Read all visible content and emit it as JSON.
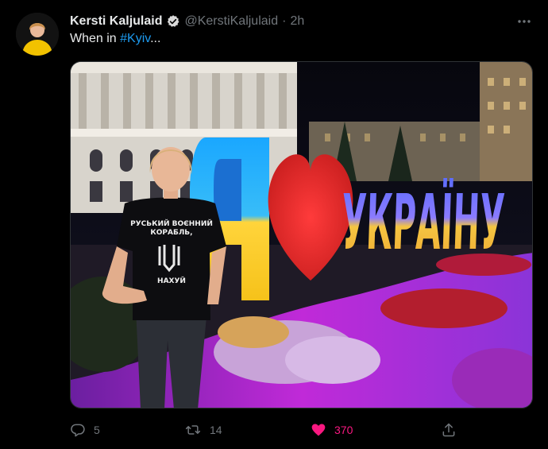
{
  "author": {
    "display_name": "Kersti Kaljulaid",
    "handle": "@KerstiKaljulaid",
    "separator": "·",
    "time": "2h",
    "verified": true
  },
  "tweet": {
    "text_prefix": "When in ",
    "hashtag": "#Kyiv",
    "text_suffix": "..."
  },
  "media": {
    "shirt_lines": [
      "РУСЬКИЙ ВОЄННИЙ",
      "КОРАБЛЬ,",
      "НАХУЙ"
    ],
    "sign_text": "УКРАЇНУ"
  },
  "actions": {
    "replies": "5",
    "retweets": "14",
    "likes": "370",
    "liked": true
  },
  "icons": {
    "verified": "verified-badge-icon",
    "more": "more-dots-icon",
    "reply": "reply-bubble-icon",
    "retweet": "retweet-icon",
    "like": "heart-icon",
    "share": "share-upload-icon"
  },
  "colors": {
    "background": "#000000",
    "text": "#e7e9ea",
    "muted": "#71767b",
    "link": "#1d9bf0",
    "like": "#f91880"
  }
}
